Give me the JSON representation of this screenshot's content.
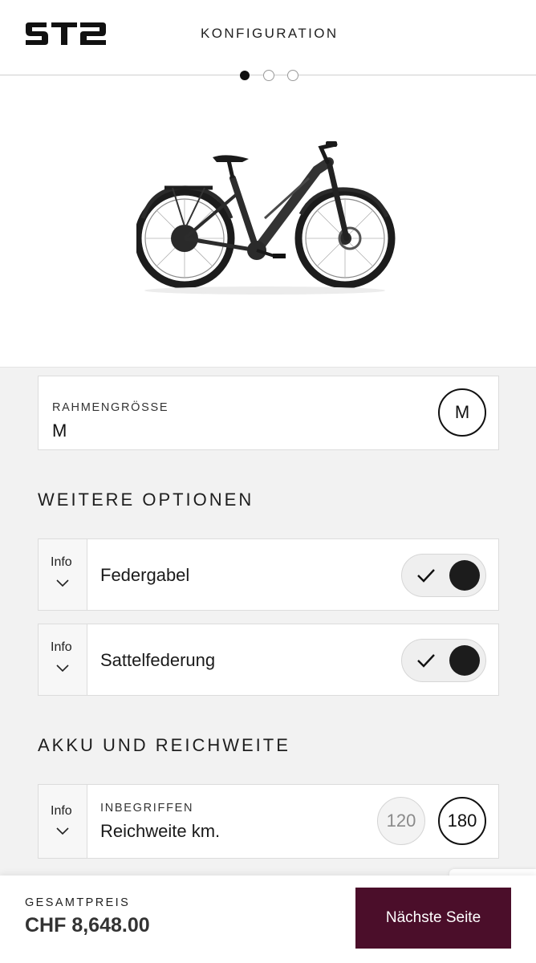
{
  "header": {
    "title": "KONFIGURATION"
  },
  "carousel": {
    "current": 1,
    "total": 3
  },
  "frame_size": {
    "label": "RAHMENGRÖSSE",
    "value": "M",
    "option": "M"
  },
  "options_section": {
    "title": "WEITERE OPTIONEN",
    "items": [
      {
        "info_label": "Info",
        "label": "Federgabel",
        "enabled": true
      },
      {
        "info_label": "Info",
        "label": "Sattelfederung",
        "enabled": true
      }
    ]
  },
  "battery_section": {
    "title": "AKKU UND REICHWEITE",
    "info_label": "Info",
    "sublabel": "INBEGRIFFEN",
    "label": "Reichweite km.",
    "choices": [
      "120",
      "180"
    ],
    "selected": "180"
  },
  "footer": {
    "total_label": "GESAMTPREIS",
    "total_value": "CHF 8,648.00",
    "next_label": "Nächste Seite"
  },
  "colors": {
    "brand_button": "#4b0e2a",
    "background": "#f2f2f2",
    "card": "#ffffff"
  },
  "icons": [
    "st2-logo",
    "chevron-down-icon",
    "check-icon"
  ]
}
